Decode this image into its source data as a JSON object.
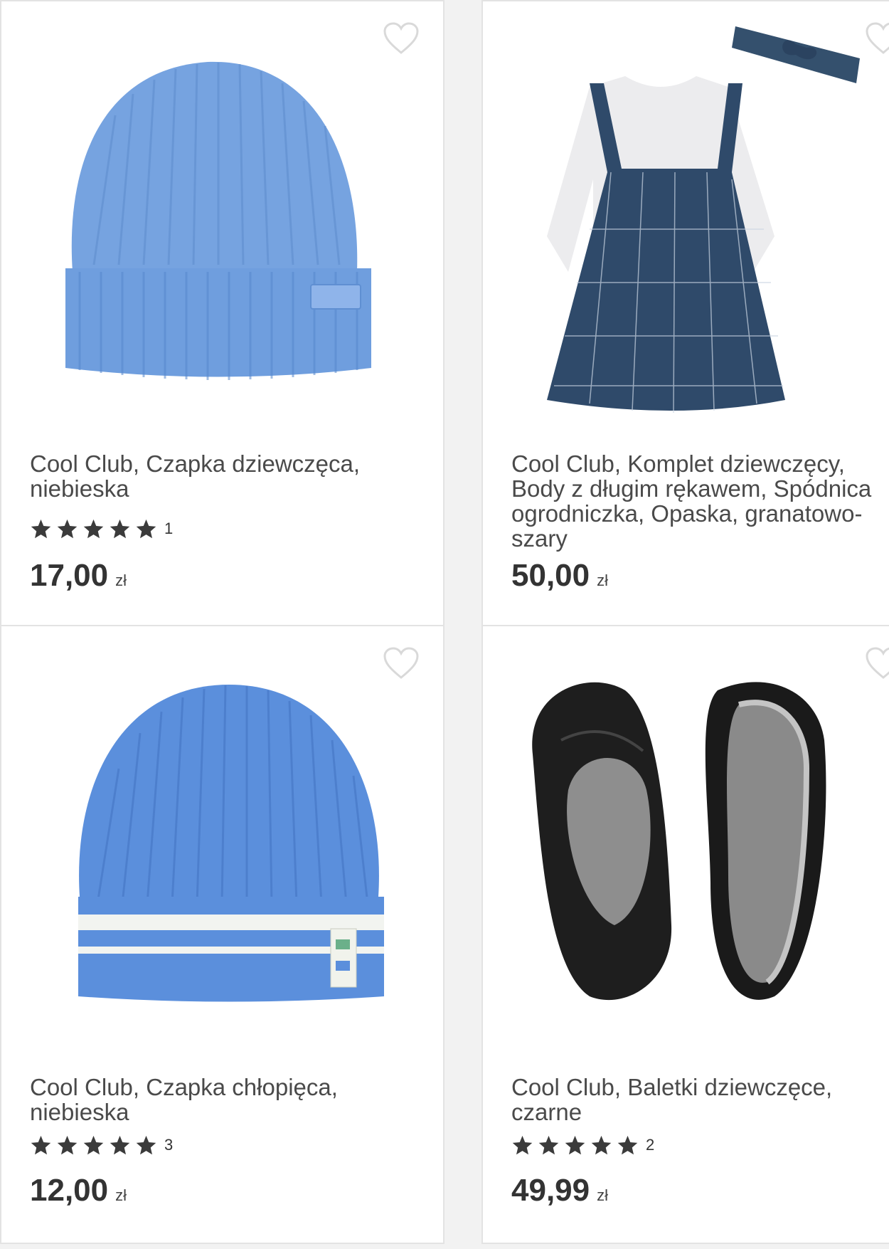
{
  "products": [
    {
      "title": "Cool Club, Czapka dziewczęca, niebieska",
      "title_lines": [
        "Cool Club, Czapka dziewczęca,",
        "niebieska"
      ],
      "rating_stars": 5,
      "rating_count": "1",
      "price": "17,00",
      "currency": "zł",
      "image": "blue-knit-beanie-with-patch",
      "color": "#6f9ede"
    },
    {
      "title": "Cool Club, Komplet dziewczęcy, Body z długim rękawem, Spódnica ogrodniczka, Opaska, granatowo-szary",
      "title_lines": [
        "Cool Club, Komplet dziewczęcy,",
        "Body z długim rękawem, Spódnica",
        "ogrodniczka, Opaska, granatowo-",
        "szary"
      ],
      "rating_stars": null,
      "rating_count": "",
      "price": "50,00",
      "currency": "zł",
      "image": "navy-check-pinafore-dress-set",
      "color": "#2f4560"
    },
    {
      "title": "Cool Club, Czapka chłopięca, niebieska",
      "title_lines": [
        "Cool Club, Czapka chłopięca,",
        "niebieska"
      ],
      "rating_stars": 5,
      "rating_count": "3",
      "price": "12,00",
      "currency": "zł",
      "image": "blue-striped-beanie",
      "color": "#5b8fdc"
    },
    {
      "title": "Cool Club, Baletki dziewczęce, czarne",
      "title_lines": [
        "Cool Club, Baletki dziewczęce,",
        "czarne"
      ],
      "rating_stars": 5,
      "rating_count": "2",
      "price": "49,99",
      "currency": "zł",
      "image": "black-ballet-slippers",
      "color": "#1c1c1c"
    }
  ],
  "colors": {
    "background": "#f2f2f2",
    "card": "#ffffff",
    "border": "#e3e3e3",
    "text": "#4a4a4a",
    "star": "#3b3b3b",
    "heart_outline": "#d9d9d9"
  },
  "icons": {
    "favorite": "heart-outline-icon",
    "rating": "star-icon"
  }
}
